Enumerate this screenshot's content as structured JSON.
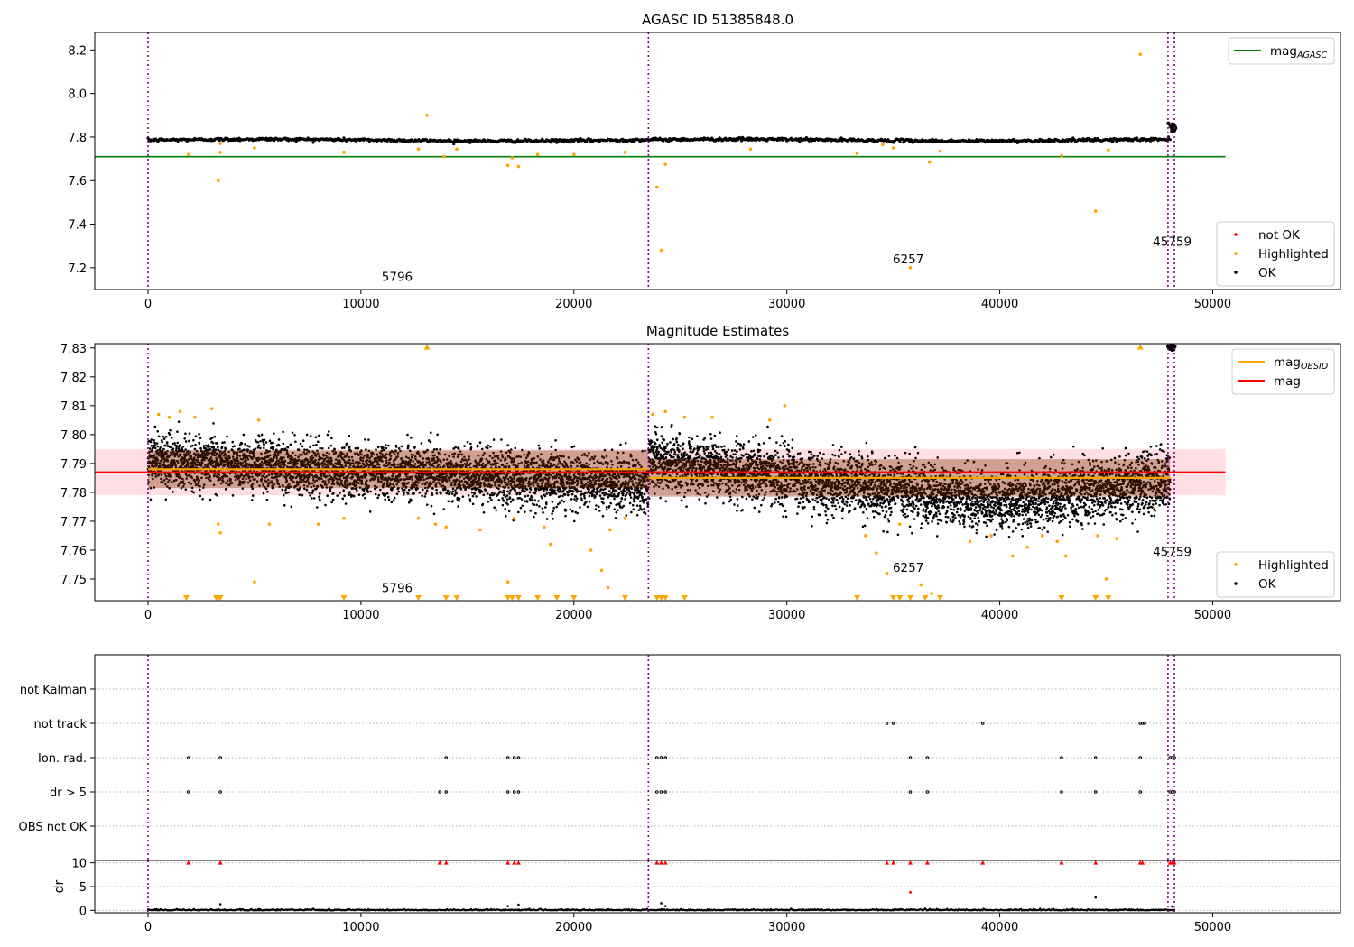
{
  "chart_data": [
    {
      "id": "top",
      "type": "scatter",
      "title": "AGASC ID 51385848.0",
      "xlim": [
        -2500,
        56000
      ],
      "ylim": [
        7.1,
        8.28
      ],
      "xticks": [
        0,
        10000,
        20000,
        30000,
        40000,
        50000
      ],
      "yticks": [
        7.2,
        7.4,
        7.6,
        7.8,
        8.0,
        8.2
      ],
      "ytick_labels": [
        "7.2",
        "7.4",
        "7.6",
        "7.8",
        "8.0",
        "8.2"
      ],
      "grid": false,
      "vlines": [
        0,
        23500,
        47900,
        48200
      ],
      "hlines": [
        {
          "y": 7.71,
          "xmin": -2500,
          "xmax": 50600,
          "color": "#008000"
        }
      ],
      "ok_band": {
        "x": [
          0,
          48000
        ],
        "y_center": 7.786,
        "spread": 0.01
      },
      "ok_cluster_end": {
        "x": 48150,
        "y": 7.845
      },
      "highlighted": [
        [
          3300,
          7.6
        ],
        [
          3400,
          7.77
        ],
        [
          3400,
          7.73
        ],
        [
          5000,
          7.75
        ],
        [
          9200,
          7.73
        ],
        [
          12700,
          7.745
        ],
        [
          13100,
          7.9
        ],
        [
          13900,
          7.71
        ],
        [
          14500,
          7.745
        ],
        [
          16900,
          7.67
        ],
        [
          17100,
          7.705
        ],
        [
          17400,
          7.665
        ],
        [
          18300,
          7.72
        ],
        [
          20000,
          7.72
        ],
        [
          22400,
          7.73
        ],
        [
          23900,
          7.57
        ],
        [
          24100,
          7.28
        ],
        [
          24300,
          7.675
        ],
        [
          28300,
          7.745
        ],
        [
          33300,
          7.725
        ],
        [
          34500,
          7.765
        ],
        [
          35000,
          7.75
        ],
        [
          35800,
          7.2
        ],
        [
          36700,
          7.685
        ],
        [
          37200,
          7.735
        ],
        [
          42900,
          7.715
        ],
        [
          44500,
          7.46
        ],
        [
          45100,
          7.74
        ],
        [
          46600,
          8.18
        ],
        [
          1900,
          7.72
        ]
      ],
      "annotations": [
        {
          "text": "5796",
          "x": 11700,
          "y": 7.14
        },
        {
          "text": "6257",
          "x": 35700,
          "y": 7.22
        },
        {
          "text": "45759",
          "x": 48100,
          "y": 7.3
        }
      ],
      "legends": [
        {
          "position": "top-right",
          "entries": [
            {
              "label": "mag",
              "sub": "AGASC",
              "kind": "line",
              "color": "#008000"
            }
          ]
        },
        {
          "position": "bottom-right",
          "entries": [
            {
              "label": "not OK",
              "kind": "dot",
              "color": "#ff0000"
            },
            {
              "label": "Highlighted",
              "kind": "dot",
              "color": "#ffa500"
            },
            {
              "label": "OK",
              "kind": "dot",
              "color": "#000000"
            }
          ]
        }
      ]
    },
    {
      "id": "middle",
      "type": "scatter",
      "title": "Magnitude Estimates",
      "xlim": [
        -2500,
        56000
      ],
      "ylim": [
        7.7425,
        7.8315
      ],
      "xticks": [
        0,
        10000,
        20000,
        30000,
        40000,
        50000
      ],
      "yticks": [
        7.75,
        7.76,
        7.77,
        7.78,
        7.79,
        7.8,
        7.81,
        7.82,
        7.83
      ],
      "ytick_labels": [
        "7.75",
        "7.76",
        "7.77",
        "7.78",
        "7.79",
        "7.80",
        "7.81",
        "7.82",
        "7.83"
      ],
      "grid": false,
      "vlines": [
        0,
        23500,
        47900,
        48200
      ],
      "mag_band": {
        "y_low": 7.779,
        "y_high": 7.795,
        "xmin": -2500,
        "xmax": 50600
      },
      "mag_line": {
        "y": 7.787,
        "xmin": -2500,
        "xmax": 50600,
        "color": "#ff0000"
      },
      "obsid_segments": [
        {
          "x0": 0,
          "x1": 23500,
          "y": 7.788
        },
        {
          "x0": 23500,
          "x1": 48000,
          "y": 7.785
        }
      ],
      "ok_segments": [
        {
          "x0": 0,
          "x1": 23500,
          "y0": 7.791,
          "y1": 7.783,
          "spread": 0.0045
        },
        {
          "x0": 23500,
          "x1": 40000,
          "y0": 7.791,
          "y1": 7.777,
          "spread": 0.005
        },
        {
          "x0": 40000,
          "x1": 48000,
          "y0": 7.777,
          "y1": 7.784,
          "spread": 0.005
        }
      ],
      "highlighted": [
        [
          500,
          7.807
        ],
        [
          1000,
          7.806
        ],
        [
          1500,
          7.808
        ],
        [
          2200,
          7.806
        ],
        [
          3000,
          7.809
        ],
        [
          3300,
          7.769
        ],
        [
          3400,
          7.766
        ],
        [
          5200,
          7.805
        ],
        [
          5700,
          7.769
        ],
        [
          5000,
          7.749
        ],
        [
          8000,
          7.769
        ],
        [
          9200,
          7.771
        ],
        [
          12700,
          7.771
        ],
        [
          13500,
          7.769
        ],
        [
          14000,
          7.768
        ],
        [
          15600,
          7.767
        ],
        [
          16900,
          7.749
        ],
        [
          17200,
          7.771
        ],
        [
          18600,
          7.768
        ],
        [
          18900,
          7.762
        ],
        [
          20800,
          7.76
        ],
        [
          21300,
          7.753
        ],
        [
          21700,
          7.767
        ],
        [
          21600,
          7.747
        ],
        [
          22400,
          7.771
        ],
        [
          23700,
          7.807
        ],
        [
          24300,
          7.808
        ],
        [
          25200,
          7.806
        ],
        [
          26500,
          7.806
        ],
        [
          29200,
          7.805
        ],
        [
          29900,
          7.81
        ],
        [
          33700,
          7.765
        ],
        [
          34200,
          7.759
        ],
        [
          34700,
          7.752
        ],
        [
          35300,
          7.769
        ],
        [
          36300,
          7.748
        ],
        [
          36800,
          7.745
        ],
        [
          38600,
          7.763
        ],
        [
          39600,
          7.765
        ],
        [
          40600,
          7.758
        ],
        [
          41300,
          7.761
        ],
        [
          42000,
          7.765
        ],
        [
          42700,
          7.763
        ],
        [
          43100,
          7.758
        ],
        [
          44600,
          7.765
        ],
        [
          45000,
          7.75
        ],
        [
          45500,
          7.764
        ]
      ],
      "highlighted_up": [
        [
          13100,
          7.831
        ],
        [
          46600,
          7.831
        ]
      ],
      "highlighted_down": [
        1800,
        3200,
        3300,
        3400,
        9200,
        12700,
        14000,
        14500,
        16900,
        17100,
        17400,
        18300,
        19200,
        20000,
        22400,
        23900,
        24100,
        24300,
        25200,
        33300,
        35000,
        35300,
        35800,
        36500,
        37200,
        42900,
        44500,
        45100
      ],
      "ok_cluster_end": {
        "x": 48100,
        "y": 7.831
      },
      "annotations": [
        {
          "text": "5796",
          "x": 11700,
          "y": 7.7455
        },
        {
          "text": "6257",
          "x": 35700,
          "y": 7.7525
        },
        {
          "text": "45759",
          "x": 48100,
          "y": 7.758
        }
      ],
      "legends": [
        {
          "position": "top-right",
          "entries": [
            {
              "label": "mag",
              "sub": "OBSID",
              "kind": "line",
              "color": "#ffa500"
            },
            {
              "label": "mag",
              "kind": "line",
              "color": "#ff0000"
            }
          ]
        },
        {
          "position": "bottom-right",
          "entries": [
            {
              "label": "Highlighted",
              "kind": "dot",
              "color": "#ffa500"
            },
            {
              "label": "OK",
              "kind": "dot",
              "color": "#000000"
            }
          ]
        }
      ]
    },
    {
      "id": "flags",
      "type": "scatter",
      "xlim": [
        -2500,
        56000
      ],
      "yticks": [
        0,
        1,
        2,
        3,
        4,
        5
      ],
      "ytick_labels": [
        "OBS not OK",
        "dr > 5",
        "Ion. rad.",
        "not track",
        "not Kalman"
      ],
      "grid": true,
      "vlines": [
        0,
        23500,
        47900,
        48200
      ],
      "rows": [
        {
          "label": "not Kalman",
          "x": []
        },
        {
          "label": "not track",
          "x": [
            34700,
            35000,
            39200,
            46600,
            46700,
            46800
          ]
        },
        {
          "label": "Ion. rad.",
          "x": [
            1900,
            3400,
            14000,
            16900,
            17200,
            17400,
            23900,
            24100,
            24300,
            35800,
            36600,
            42900,
            44500,
            46600,
            48000,
            48100,
            48200
          ]
        },
        {
          "label": "dr > 5",
          "x": [
            1900,
            3400,
            13700,
            14000,
            16900,
            17200,
            17400,
            23900,
            24100,
            24300,
            35800,
            36600,
            42900,
            44500,
            46600,
            48000,
            48100,
            48200
          ]
        },
        {
          "label": "OBS not OK",
          "x": []
        }
      ]
    },
    {
      "id": "dr",
      "type": "scatter",
      "ylabel": "dr",
      "xlim": [
        -2500,
        56000
      ],
      "ylim": [
        -0.5,
        10.5
      ],
      "xticks": [
        0,
        10000,
        20000,
        30000,
        40000,
        50000
      ],
      "yticks": [
        0,
        5,
        10
      ],
      "ytick_labels": [
        "0",
        "5",
        "10"
      ],
      "grid": true,
      "vlines": [
        0,
        23500,
        47900,
        48200
      ],
      "capped_red": [
        1900,
        3400,
        13700,
        14000,
        16900,
        17200,
        17400,
        23900,
        24100,
        24300,
        34700,
        35000,
        35800,
        36600,
        39200,
        42900,
        44500,
        46600,
        46700,
        48000,
        48100,
        48200
      ],
      "red_points": [
        [
          35800,
          3.8
        ]
      ],
      "black_points": [
        [
          3400,
          1.3
        ],
        [
          17400,
          1.2
        ],
        [
          16900,
          0.9
        ],
        [
          24100,
          1.5
        ],
        [
          24300,
          0.9
        ],
        [
          44500,
          2.7
        ],
        [
          48100,
          0.8
        ]
      ],
      "x_range": [
        0,
        48200
      ]
    }
  ]
}
